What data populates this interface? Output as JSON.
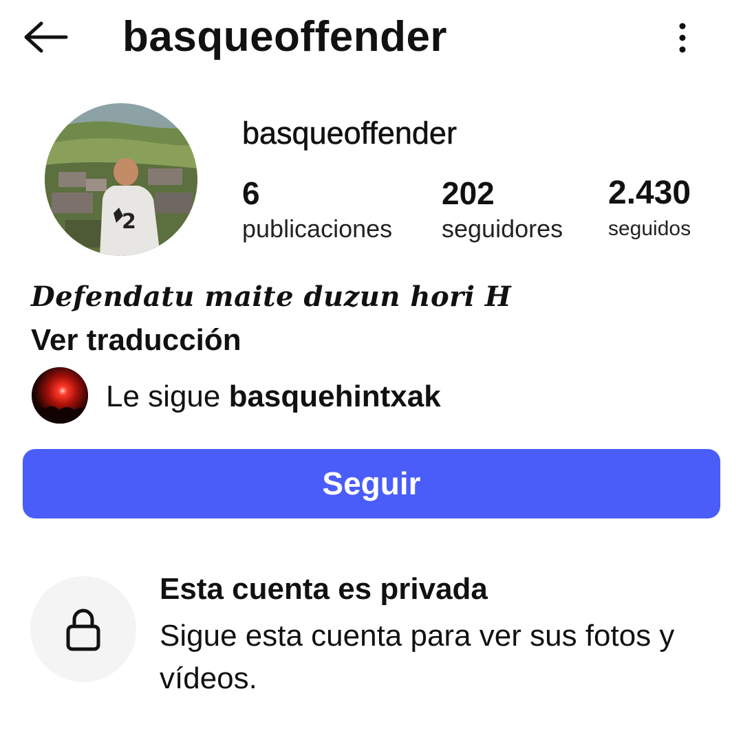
{
  "header": {
    "title": "basqueoffender",
    "back_icon": "arrow-left-icon",
    "more_icon": "more-vertical-icon"
  },
  "profile": {
    "username": "basqueoffender",
    "stats": [
      {
        "value": "6",
        "label": "publicaciones"
      },
      {
        "value": "202",
        "label": "seguidores"
      },
      {
        "value": "2.430",
        "label": "seguidos"
      }
    ],
    "bio": "Defendatu maite duzun hori H",
    "translate_link": "Ver traducción"
  },
  "followed_by": {
    "prefix": "Le sigue ",
    "user": "basquehintxak"
  },
  "follow_button": {
    "label": "Seguir",
    "color": "#4a5df9"
  },
  "private_notice": {
    "icon": "lock-icon",
    "title": "Esta cuenta es privada",
    "description": "Sigue esta cuenta para ver sus fotos y vídeos."
  }
}
